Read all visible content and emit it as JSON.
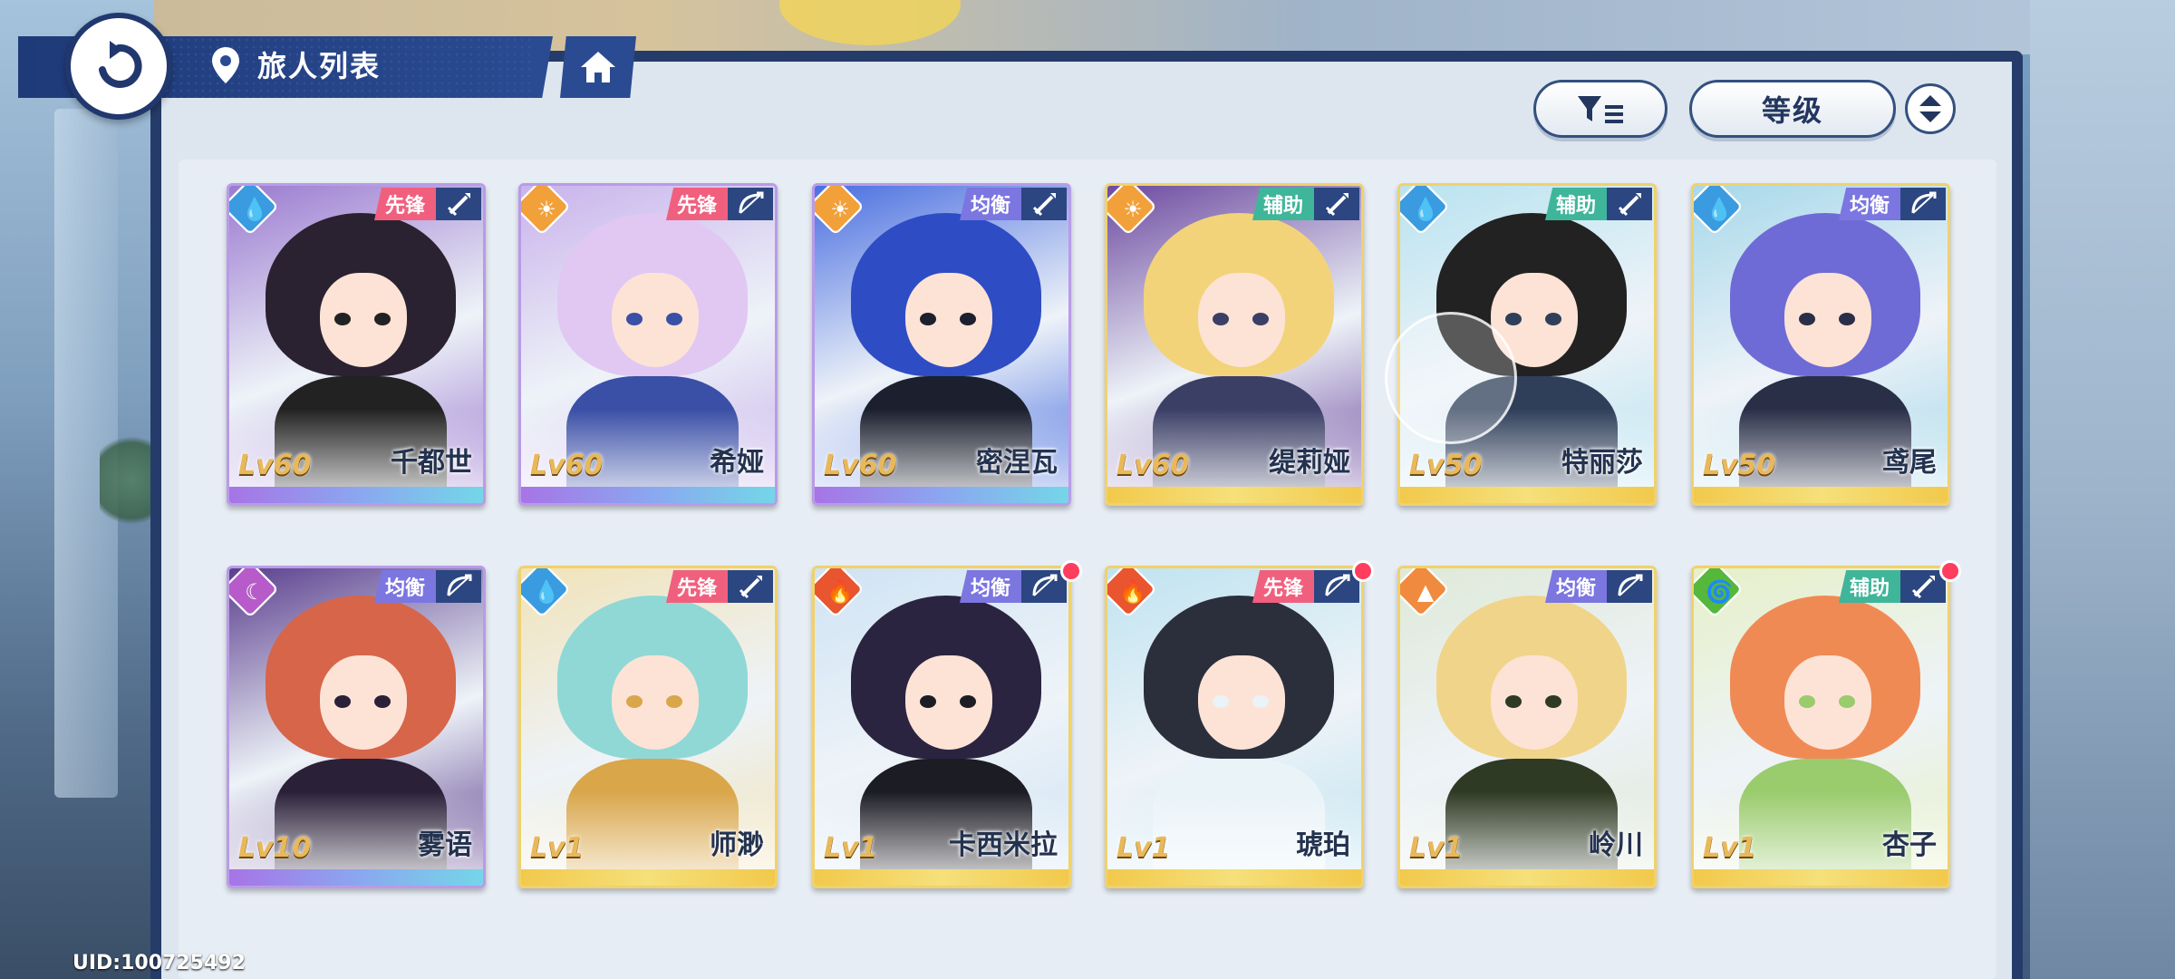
{
  "header": {
    "title": "旅人列表"
  },
  "sort": {
    "label": "等级"
  },
  "uid": "UID:100725492",
  "colors": {
    "navy": "#253c6a",
    "role_vanguard": "#f0607e",
    "role_balance": "#7b76e0",
    "role_support": "#3fb59a",
    "element_water": "#3a9be0",
    "element_sun": "#f2a03a",
    "element_fire": "#e8552e",
    "element_moon": "#b65bc9",
    "element_earth": "#f08a3e",
    "element_wind": "#55b73c"
  },
  "cards": [
    {
      "level": "Lv60",
      "name": "千都世",
      "role": "先锋",
      "weapon": "sword",
      "element": "water",
      "frame": "purple"
    },
    {
      "level": "Lv60",
      "name": "希娅",
      "role": "先锋",
      "weapon": "bow",
      "element": "sun",
      "frame": "purple"
    },
    {
      "level": "Lv60",
      "name": "密涅瓦",
      "role": "均衡",
      "weapon": "sword",
      "element": "sun",
      "frame": "purple"
    },
    {
      "level": "Lv60",
      "name": "缇莉娅",
      "role": "辅助",
      "weapon": "sword",
      "element": "sun",
      "frame": "gold"
    },
    {
      "level": "Lv50",
      "name": "特丽莎",
      "role": "辅助",
      "weapon": "sword",
      "element": "water",
      "frame": "gold"
    },
    {
      "level": "Lv50",
      "name": "鸢尾",
      "role": "均衡",
      "weapon": "bow",
      "element": "water",
      "frame": "gold"
    },
    {
      "level": "Lv10",
      "name": "雾语",
      "role": "均衡",
      "weapon": "bow",
      "element": "moon",
      "frame": "purple"
    },
    {
      "level": "Lv1",
      "name": "师渺",
      "role": "先锋",
      "weapon": "sword",
      "element": "water",
      "frame": "gold"
    },
    {
      "level": "Lv1",
      "name": "卡西米拉",
      "role": "均衡",
      "weapon": "bow",
      "element": "fire",
      "frame": "gold"
    },
    {
      "level": "Lv1",
      "name": "琥珀",
      "role": "先锋",
      "weapon": "bow",
      "element": "fire",
      "frame": "gold"
    },
    {
      "level": "Lv1",
      "name": "岭川",
      "role": "均衡",
      "weapon": "bow",
      "element": "earth",
      "frame": "gold"
    },
    {
      "level": "Lv1",
      "name": "杏子",
      "role": "辅助",
      "weapon": "sword",
      "element": "wind",
      "frame": "gold"
    }
  ]
}
